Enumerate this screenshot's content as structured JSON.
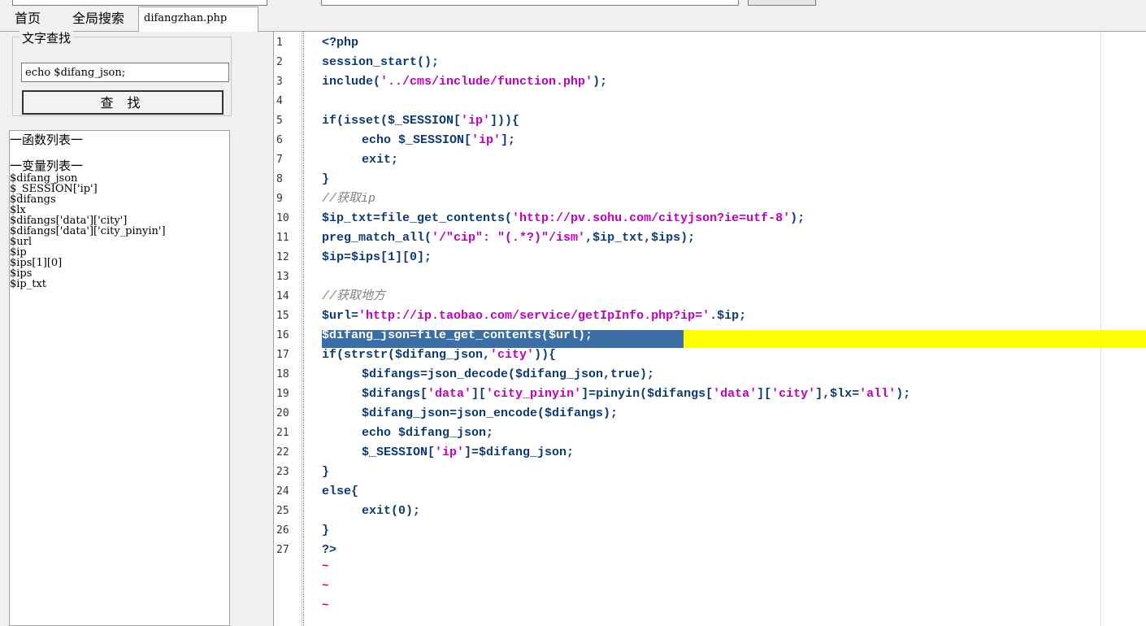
{
  "tabs": [
    "首页",
    "全局搜索",
    "difangzhan.php"
  ],
  "search": {
    "legend": "文字查找",
    "value": "echo $difang_json;",
    "button": "查 找"
  },
  "sidebar": {
    "func_header": "一函数列表一",
    "var_header": "一变量列表一",
    "vars": [
      "$difang_json",
      "$_SESSION['ip']",
      "$difangs",
      "$lx",
      "$difangs['data']['city']",
      "$difangs['data']['city_pinyin']",
      "$url",
      "$ip",
      "$ips[1][0]",
      "$ips",
      "$ip_txt"
    ]
  },
  "editor": {
    "line_numbers": [
      "1",
      "2",
      "3",
      "4",
      "5",
      "6",
      "7",
      "8",
      "9",
      "10",
      "11",
      "12",
      "13",
      "14",
      "15",
      "16",
      "17",
      "18",
      "19",
      "20",
      "21",
      "22",
      "23",
      "24",
      "25",
      "26",
      "27"
    ],
    "lines": [
      "<?php",
      "session_start();",
      "include('../cms/include/function.php');",
      "",
      "if(isset($_SESSION['ip'])){",
      "\techo $_SESSION['ip'];",
      "\texit;",
      "}",
      "//获取ip",
      "$ip_txt=file_get_contents('http://pv.sohu.com/cityjson?ie=utf-8');",
      "preg_match_all('/\"cip\": \"(.*?)\"/ism',$ip_txt,$ips);",
      "$ip=$ips[1][0];",
      "",
      "//获取地方",
      "$url='http://ip.taobao.com/service/getIpInfo.php?ip='.$ip;",
      "$difang_json=file_get_contents($url);",
      "if(strstr($difang_json,'city')){",
      "\t$difangs=json_decode($difang_json,true);",
      "\t$difangs['data']['city_pinyin']=pinyin($difangs['data']['city'],$lx='all');",
      "\t$difang_json=json_encode($difangs);",
      "\techo $difang_json;",
      "\t$_SESSION['ip']=$difang_json;",
      "}",
      "else{",
      "\texit(0);",
      "}",
      "?>"
    ],
    "selected_line": 16,
    "tilde": "~",
    "colors": {
      "keyword": "#0a3a7a",
      "string": "#c000c0",
      "comment": "#808080",
      "highlight": "#ffff00",
      "selection": "#3a6ea5"
    }
  }
}
